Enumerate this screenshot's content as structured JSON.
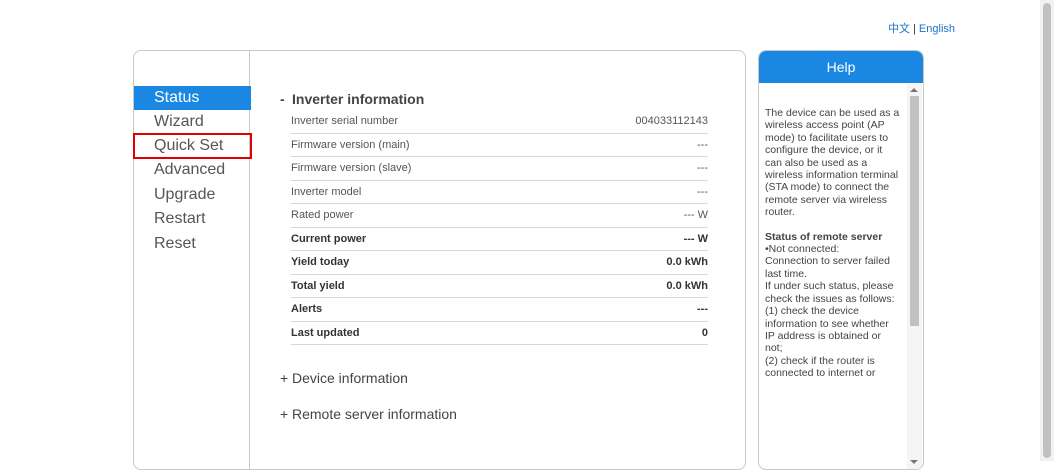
{
  "language": {
    "chinese": "中文",
    "english": "English",
    "separator": "|"
  },
  "nav": {
    "items": [
      {
        "label": "Status"
      },
      {
        "label": "Wizard"
      },
      {
        "label": "Quick Set"
      },
      {
        "label": "Advanced"
      },
      {
        "label": "Upgrade"
      },
      {
        "label": "Restart"
      },
      {
        "label": "Reset"
      }
    ],
    "active": "Status",
    "highlighted": "Quick Set"
  },
  "inverter": {
    "section_sign": "-",
    "section_title": "Inverter information",
    "rows": [
      {
        "label": "Inverter serial number",
        "value": "004033112143"
      },
      {
        "label": "Firmware version (main)",
        "value": "---"
      },
      {
        "label": "Firmware version (slave)",
        "value": "---"
      },
      {
        "label": "Inverter model",
        "value": "---"
      },
      {
        "label": "Rated power",
        "value": "--- W"
      },
      {
        "label": "Current power",
        "value": "--- W"
      },
      {
        "label": "Yield today",
        "value": "0.0 kWh"
      },
      {
        "label": "Total yield",
        "value": "0.0 kWh"
      },
      {
        "label": "Alerts",
        "value": "---"
      },
      {
        "label": "Last updated",
        "value": "0"
      }
    ]
  },
  "device": {
    "sign": "+",
    "title": "Device information"
  },
  "remote": {
    "sign": "+",
    "title": "Remote server information"
  },
  "help": {
    "title": "Help",
    "intro": "The device can be used as a wireless access point (AP mode) to facilitate users to configure the device, or it can also be used as a wireless information terminal (STA mode) to connect the remote server via wireless router.",
    "status_title": "Status of remote server",
    "lines": [
      "•Not connected:",
      "Connection to server failed last time.",
      "If under such status, please check the issues as follows:",
      "(1) check the device information to see whether IP address is obtained or not;",
      "(2) check if the router is connected to internet or"
    ]
  },
  "colors": {
    "accent": "#1a88e2",
    "highlight_outline": "#e00000",
    "link": "#1a73c8"
  }
}
